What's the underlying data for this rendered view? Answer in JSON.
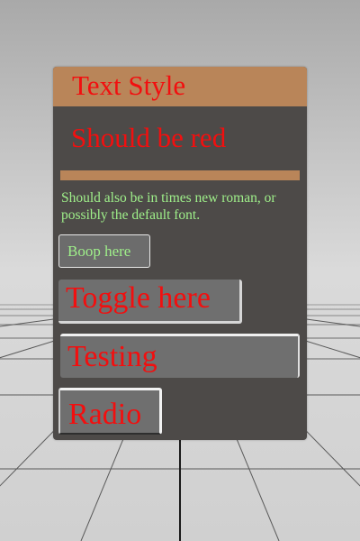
{
  "panel": {
    "header_title": "Text Style",
    "red_text": "Should be red",
    "green_text": "Should also be in times new roman, or possibly the default font.",
    "boop_button_label": "Boop here",
    "toggle_label": "Toggle here",
    "input_value": "Testing",
    "radio_label": "Radio"
  },
  "colors": {
    "panel_background": "#4d4a48",
    "header_background": "#b98559",
    "red_text": "#f20f0f",
    "green_text": "#9ff08a",
    "control_background": "#6f6f6f"
  }
}
